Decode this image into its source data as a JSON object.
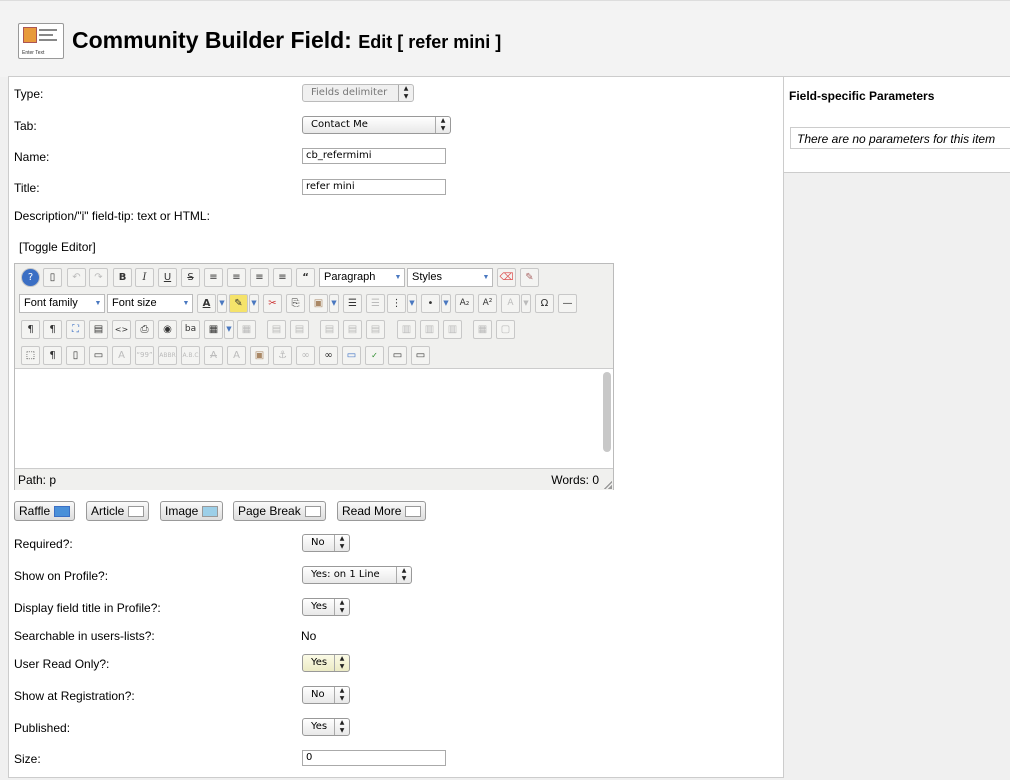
{
  "header": {
    "title": "Community Builder Field:",
    "subtitle": "Edit [ refer mini ]",
    "icon_text": "Enter Text"
  },
  "form": {
    "type": {
      "label": "Type:",
      "value": "Fields delimiter"
    },
    "tab": {
      "label": "Tab:",
      "value": "Contact Me"
    },
    "name": {
      "label": "Name:",
      "value": "cb_refermimi"
    },
    "title": {
      "label": "Title:",
      "value": "refer mini"
    },
    "description": {
      "label": "Description/\"i\" field-tip: text or HTML:"
    },
    "toggle_editor": "[Toggle Editor]"
  },
  "editor": {
    "format_select": "Paragraph",
    "styles_select": "Styles",
    "font_family_select": "Font family",
    "font_size_select": "Font size",
    "path_label": "Path:",
    "path_value": "p",
    "words": "Words: 0"
  },
  "buttons": {
    "raffle": "Raffle",
    "article": "Article",
    "image": "Image",
    "page_break": "Page Break",
    "read_more": "Read More"
  },
  "options": {
    "required": {
      "label": "Required?:",
      "value": "No"
    },
    "show_on_profile": {
      "label": "Show on Profile?:",
      "value": "Yes: on 1 Line"
    },
    "display_title": {
      "label": "Display field title in Profile?:",
      "value": "Yes"
    },
    "searchable": {
      "label": "Searchable in users-lists?:",
      "value": "No"
    },
    "user_read_only": {
      "label": "User Read Only?:",
      "value": "Yes"
    },
    "show_at_registration": {
      "label": "Show at Registration?:",
      "value": "No"
    },
    "published": {
      "label": "Published:",
      "value": "Yes"
    },
    "size": {
      "label": "Size:",
      "value": "0"
    }
  },
  "sidebar": {
    "title": "Field-specific Parameters",
    "note": "There are no parameters for this item"
  },
  "colors": {
    "background": "#f0f0f0",
    "panel": "#ffffff",
    "border": "#cccccc",
    "toolbar": "#f0f0ee"
  }
}
